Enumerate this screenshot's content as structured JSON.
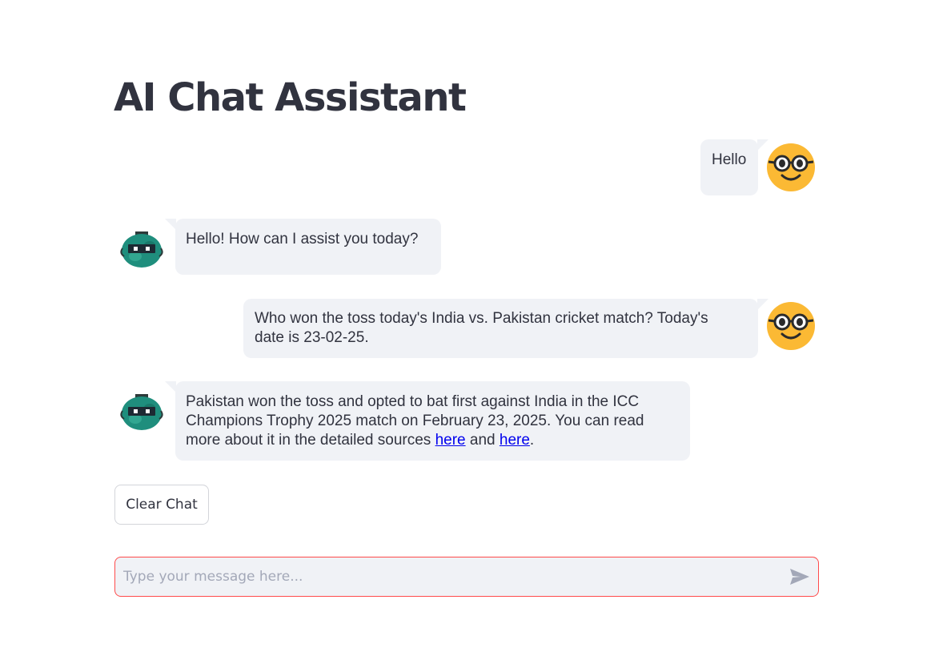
{
  "page": {
    "title": "AI Chat Assistant"
  },
  "messages": [
    {
      "role": "user",
      "text": "Hello"
    },
    {
      "role": "assistant",
      "text": "Hello! How can I assist you today?"
    },
    {
      "role": "user",
      "lines": [
        "Who won the toss today's India vs. Pakistan cricket match? Today's",
        "date is 23-02-25."
      ]
    },
    {
      "role": "assistant",
      "lines": [
        "Pakistan won the toss and opted to bat first against India in the ICC",
        "Champions Trophy 2025 match on February 23, 2025. You can read"
      ],
      "line3_prefix": "more about it in the detailed sources ",
      "link1": "here",
      "middle": " and ",
      "link2": "here",
      "suffix": "."
    }
  ],
  "controls": {
    "clear_label": "Clear Chat",
    "input_placeholder": "Type your message here...",
    "input_value": ""
  },
  "icons": {
    "user_avatar": "nerd-face-icon",
    "assistant_avatar": "robot-avatar-icon",
    "send": "send-icon"
  },
  "colors": {
    "bubble_bg": "#f0f2f6",
    "text": "#31333f",
    "input_border": "#ff4b4b",
    "link": "#0000ee",
    "user_avatar": "#fbb934",
    "bot_avatar": "#1f8e7d"
  }
}
